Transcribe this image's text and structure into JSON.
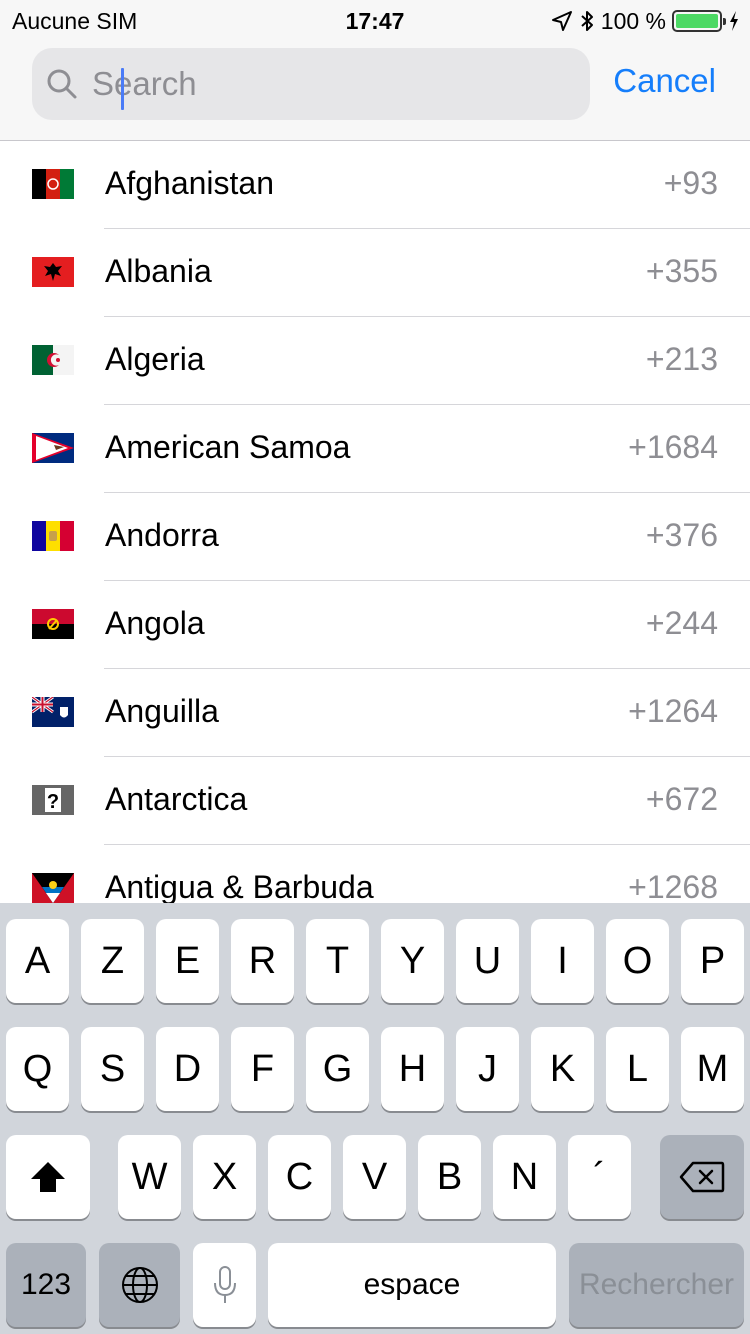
{
  "status_bar": {
    "carrier": "Aucune SIM",
    "time": "17:47",
    "battery_text": "100 %",
    "battery_level": 1.0,
    "battery_color": "#4cd964"
  },
  "search": {
    "placeholder": "Search",
    "value": "",
    "cancel_label": "Cancel"
  },
  "countries": [
    {
      "name": "Afghanistan",
      "code": "+93"
    },
    {
      "name": "Albania",
      "code": "+355"
    },
    {
      "name": "Algeria",
      "code": "+213"
    },
    {
      "name": "American Samoa",
      "code": "+1684"
    },
    {
      "name": "Andorra",
      "code": "+376"
    },
    {
      "name": "Angola",
      "code": "+244"
    },
    {
      "name": "Anguilla",
      "code": "+1264"
    },
    {
      "name": "Antarctica",
      "code": "+672"
    },
    {
      "name": "Antigua & Barbuda",
      "code": "+1268"
    }
  ],
  "keyboard": {
    "row1": [
      "A",
      "Z",
      "E",
      "R",
      "T",
      "Y",
      "U",
      "I",
      "O",
      "P"
    ],
    "row2": [
      "Q",
      "S",
      "D",
      "F",
      "G",
      "H",
      "J",
      "K",
      "L",
      "M"
    ],
    "row3": [
      "W",
      "X",
      "C",
      "V",
      "B",
      "N",
      "´"
    ],
    "numbers_label": "123",
    "space_label": "espace",
    "return_label": "Rechercher"
  },
  "colors": {
    "accent": "#157efb",
    "secondary_text": "#8e8e93",
    "keyboard_bg": "#d1d5db"
  }
}
